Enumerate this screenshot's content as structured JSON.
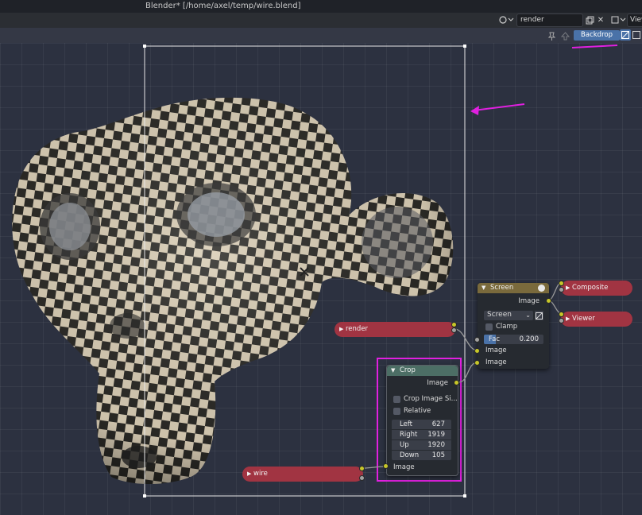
{
  "window": {
    "title": "Blender* [/home/axel/temp/wire.blend]"
  },
  "topbar": {
    "scene_field": "render",
    "view_label": "View"
  },
  "header": {
    "backdrop_label": "Backdrop"
  },
  "nodes": {
    "screen": {
      "title": "Screen",
      "output_image": "Image",
      "blend_mode": "Screen",
      "clamp_label": "Clamp",
      "fac_label": "Fac",
      "fac_value": "0.200",
      "input_image_1": "Image",
      "input_image_2": "Image"
    },
    "composite": {
      "title": "Composite"
    },
    "viewer": {
      "title": "Viewer"
    },
    "render": {
      "title": "render"
    },
    "wire": {
      "title": "wire"
    },
    "crop": {
      "title": "Crop",
      "output_image": "Image",
      "crop_image_size_label": "Crop Image Si...",
      "relative_label": "Relative",
      "fields": [
        {
          "label": "Left",
          "value": "627"
        },
        {
          "label": "Right",
          "value": "1919"
        },
        {
          "label": "Up",
          "value": "1920"
        },
        {
          "label": "Down",
          "value": "105"
        }
      ],
      "input_image": "Image"
    }
  },
  "colors": {
    "annotation": "#e020e0",
    "backdrop_accent": "#4a72a8",
    "image_socket": "#c7c729",
    "input_node": "#a13442",
    "color_node_header": "#7a6a3c",
    "converter_header": "#4c6e65"
  }
}
